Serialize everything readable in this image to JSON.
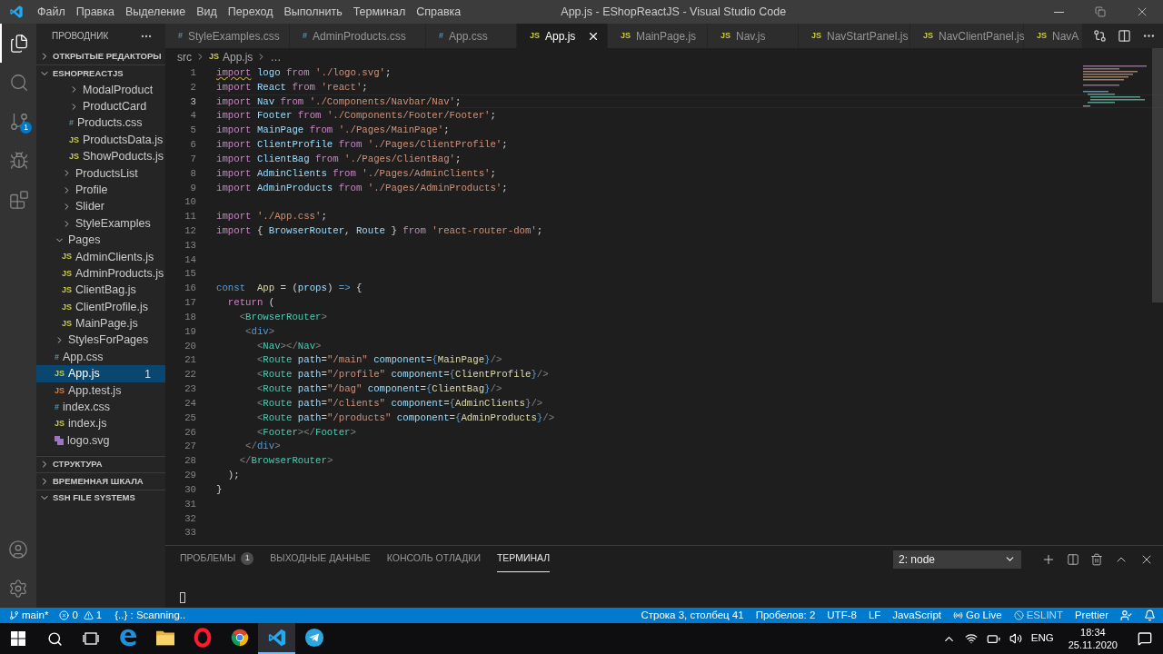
{
  "title_bar": {
    "menu": [
      "Файл",
      "Правка",
      "Выделение",
      "Вид",
      "Переход",
      "Выполнить",
      "Терминал",
      "Справка"
    ],
    "title": "App.js - EShopReactJS - Visual Studio Code"
  },
  "activity_bar": [
    {
      "kind": "files",
      "selected": true
    },
    {
      "kind": "search",
      "selected": false
    },
    {
      "kind": "scm",
      "selected": false,
      "badge": "1"
    },
    {
      "kind": "debug",
      "selected": false
    },
    {
      "kind": "extensions",
      "selected": false
    }
  ],
  "sidebar": {
    "title": "ПРОВОДНИК",
    "sections": [
      {
        "label": "ОТКРЫТЫЕ РЕДАКТОРЫ",
        "expanded": false
      },
      {
        "label": "ESHOPREACTJS",
        "expanded": true,
        "tree": [
          {
            "kind": "group",
            "children": [
              {
                "kind": "group",
                "children": [
                  {
                    "kind": "folder",
                    "label": "ModalProduct",
                    "expanded": false,
                    "selected": false
                  },
                  {
                    "kind": "folder",
                    "label": "ProductCard",
                    "expanded": false,
                    "selected": false
                  },
                  {
                    "kind": "css",
                    "icon_text": "#",
                    "label": "Products.css",
                    "selected": false
                  },
                  {
                    "kind": "js",
                    "icon_text": "JS",
                    "label": "ProductsData.js",
                    "selected": false
                  },
                  {
                    "kind": "js",
                    "icon_text": "JS",
                    "label": "ShowPoducts.js",
                    "selected": false
                  }
                ]
              },
              {
                "kind": "folder",
                "label": "ProductsList",
                "expanded": false,
                "selected": false
              },
              {
                "kind": "folder",
                "label": "Profile",
                "expanded": false,
                "selected": false
              },
              {
                "kind": "folder",
                "label": "Slider",
                "expanded": false,
                "selected": false
              },
              {
                "kind": "folder",
                "label": "StyleExamples",
                "expanded": false,
                "selected": false
              }
            ]
          },
          {
            "kind": "folder",
            "label": "Pages",
            "expanded": true,
            "selected": false,
            "children": [
              {
                "kind": "js",
                "icon_text": "JS",
                "label": "AdminClients.js",
                "selected": false
              },
              {
                "kind": "js",
                "icon_text": "JS",
                "label": "AdminProducts.js",
                "selected": false
              },
              {
                "kind": "js",
                "icon_text": "JS",
                "label": "ClientBag.js",
                "selected": false
              },
              {
                "kind": "js",
                "icon_text": "JS",
                "label": "ClientProfile.js",
                "selected": false
              },
              {
                "kind": "js",
                "icon_text": "JS",
                "label": "MainPage.js",
                "selected": false
              }
            ]
          },
          {
            "kind": "folder",
            "label": "StylesForPages",
            "expanded": false,
            "selected": false
          },
          {
            "kind": "css",
            "icon_text": "#",
            "label": "App.css",
            "selected": false
          },
          {
            "kind": "js",
            "icon_text": "JS",
            "label": "App.js",
            "selected": true,
            "badge": "1"
          },
          {
            "kind": "test",
            "icon_text": "JS",
            "label": "App.test.js",
            "selected": false
          },
          {
            "kind": "css",
            "icon_text": "#",
            "label": "index.css",
            "selected": false
          },
          {
            "kind": "js",
            "icon_text": "JS",
            "label": "index.js",
            "selected": false
          },
          {
            "kind": "svg",
            "label": "logo.svg",
            "selected": false
          }
        ]
      },
      {
        "label": "СТРУКТУРА",
        "expanded": false
      },
      {
        "label": "ВРЕМЕННАЯ ШКАЛА",
        "expanded": false
      },
      {
        "label": "SSH FILE SYSTEMS",
        "expanded": true
      }
    ]
  },
  "tabs": [
    {
      "kind": "css",
      "icon_text": "#",
      "label": "StyleExamples.css",
      "selected": false
    },
    {
      "kind": "css",
      "icon_text": "#",
      "label": "AdminProducts.css",
      "selected": false
    },
    {
      "kind": "css",
      "icon_text": "#",
      "label": "App.css",
      "selected": false
    },
    {
      "kind": "js",
      "icon_text": "JS",
      "label": "App.js",
      "selected": true
    },
    {
      "kind": "js",
      "icon_text": "JS",
      "label": "MainPage.js",
      "selected": false
    },
    {
      "kind": "js",
      "icon_text": "JS",
      "label": "Nav.js",
      "selected": false
    },
    {
      "kind": "js",
      "icon_text": "JS",
      "label": "NavStartPanel.js",
      "selected": false
    },
    {
      "kind": "js",
      "icon_text": "JS",
      "label": "NavClientPanel.js",
      "selected": false
    },
    {
      "kind": "js",
      "icon_text": "JS",
      "label": "NavA",
      "selected": false
    }
  ],
  "breadcrumb": [
    {
      "kind": "folder",
      "text": "src"
    },
    {
      "kind": "file",
      "icon_text": "JS",
      "text": "App.js"
    },
    {
      "kind": "more",
      "text": "…"
    }
  ],
  "editor": {
    "lines": [
      {
        "number": "1",
        "tokens": [
          {
            "kind": "kw",
            "text": "import",
            "warning": true
          },
          {
            "kind": "id",
            "text": " logo"
          },
          {
            "kind": "kw",
            "text": " from"
          },
          {
            "kind": "str",
            "text": " './logo.svg'"
          },
          {
            "kind": "p",
            "text": ";"
          }
        ]
      },
      {
        "number": "2",
        "tokens": [
          {
            "kind": "kw",
            "text": "import"
          },
          {
            "kind": "id",
            "text": " React"
          },
          {
            "kind": "kw",
            "text": " from"
          },
          {
            "kind": "str",
            "text": " 'react'"
          },
          {
            "kind": "p",
            "text": ";"
          }
        ]
      },
      {
        "number": "3",
        "current": true,
        "tokens": [
          {
            "kind": "kw",
            "text": "import"
          },
          {
            "kind": "id",
            "text": " Nav"
          },
          {
            "kind": "kw",
            "text": " from"
          },
          {
            "kind": "str",
            "text": " './Components/Navbar/Nav'"
          },
          {
            "kind": "p",
            "text": ";"
          }
        ]
      },
      {
        "number": "4",
        "tokens": [
          {
            "kind": "kw",
            "text": "import"
          },
          {
            "kind": "id",
            "text": " Footer"
          },
          {
            "kind": "kw",
            "text": " from"
          },
          {
            "kind": "str",
            "text": " './Components/Footer/Footer'"
          },
          {
            "kind": "p",
            "text": ";"
          }
        ]
      },
      {
        "number": "5",
        "tokens": [
          {
            "kind": "kw",
            "text": "import"
          },
          {
            "kind": "id",
            "text": " MainPage"
          },
          {
            "kind": "kw",
            "text": " from"
          },
          {
            "kind": "str",
            "text": " './Pages/MainPage'"
          },
          {
            "kind": "p",
            "text": ";"
          }
        ]
      },
      {
        "number": "6",
        "tokens": [
          {
            "kind": "kw",
            "text": "import"
          },
          {
            "kind": "id",
            "text": " ClientProfile"
          },
          {
            "kind": "kw",
            "text": " from"
          },
          {
            "kind": "str",
            "text": " './Pages/ClientProfile'"
          },
          {
            "kind": "p",
            "text": ";"
          }
        ]
      },
      {
        "number": "7",
        "tokens": [
          {
            "kind": "kw",
            "text": "import"
          },
          {
            "kind": "id",
            "text": " ClientBag"
          },
          {
            "kind": "kw",
            "text": " from"
          },
          {
            "kind": "str",
            "text": " './Pages/ClientBag'"
          },
          {
            "kind": "p",
            "text": ";"
          }
        ]
      },
      {
        "number": "8",
        "tokens": [
          {
            "kind": "kw",
            "text": "import"
          },
          {
            "kind": "id",
            "text": " AdminClients"
          },
          {
            "kind": "kw",
            "text": " from"
          },
          {
            "kind": "str",
            "text": " './Pages/AdminClients'"
          },
          {
            "kind": "p",
            "text": ";"
          }
        ]
      },
      {
        "number": "9",
        "tokens": [
          {
            "kind": "kw",
            "text": "import"
          },
          {
            "kind": "id",
            "text": " AdminProducts"
          },
          {
            "kind": "kw",
            "text": " from"
          },
          {
            "kind": "str",
            "text": " './Pages/AdminProducts'"
          },
          {
            "kind": "p",
            "text": ";"
          }
        ]
      },
      {
        "number": "10"
      },
      {
        "number": "11",
        "tokens": [
          {
            "kind": "kw",
            "text": "import"
          },
          {
            "kind": "str",
            "text": " './App.css'"
          },
          {
            "kind": "p",
            "text": ";"
          }
        ]
      },
      {
        "number": "12",
        "tokens": [
          {
            "kind": "kw",
            "text": "import"
          },
          {
            "kind": "p",
            "text": " {"
          },
          {
            "kind": "id",
            "text": " BrowserRouter"
          },
          {
            "kind": "p",
            "text": ","
          },
          {
            "kind": "id",
            "text": " Route"
          },
          {
            "kind": "p",
            "text": " }"
          },
          {
            "kind": "kw",
            "text": " from"
          },
          {
            "kind": "str",
            "text": " 'react-router-dom'"
          },
          {
            "kind": "p",
            "text": ";"
          }
        ]
      },
      {
        "number": "13"
      },
      {
        "number": "14"
      },
      {
        "number": "15"
      },
      {
        "number": "16",
        "tokens": [
          {
            "kind": "st",
            "text": "const"
          },
          {
            "kind": "fn",
            "text": "  App"
          },
          {
            "kind": "p",
            "text": " = ("
          },
          {
            "kind": "id",
            "text": "props"
          },
          {
            "kind": "p",
            "text": ")"
          },
          {
            "kind": "st",
            "text": " =>"
          },
          {
            "kind": "p",
            "text": " {"
          }
        ]
      },
      {
        "number": "17",
        "tokens": [
          {
            "kind": "kw",
            "text": "  return"
          },
          {
            "kind": "p",
            "text": " ("
          }
        ]
      },
      {
        "number": "18",
        "tokens": [
          {
            "kind": "br",
            "text": "    <"
          },
          {
            "kind": "tag",
            "text": "BrowserRouter"
          },
          {
            "kind": "br",
            "text": ">"
          }
        ]
      },
      {
        "number": "19",
        "tokens": [
          {
            "kind": "br",
            "text": "     <"
          },
          {
            "kind": "st",
            "text": "div"
          },
          {
            "kind": "br",
            "text": ">"
          }
        ]
      },
      {
        "number": "20",
        "tokens": [
          {
            "kind": "br",
            "text": "       <"
          },
          {
            "kind": "tag",
            "text": "Nav"
          },
          {
            "kind": "br",
            "text": "></"
          },
          {
            "kind": "tag",
            "text": "Nav"
          },
          {
            "kind": "br",
            "text": ">"
          }
        ]
      },
      {
        "number": "21",
        "tokens": [
          {
            "kind": "br",
            "text": "       <"
          },
          {
            "kind": "tag",
            "text": "Route"
          },
          {
            "kind": "attr",
            "text": " path"
          },
          {
            "kind": "p",
            "text": "="
          },
          {
            "kind": "str",
            "text": "\"/main\""
          },
          {
            "kind": "attr",
            "text": " component"
          },
          {
            "kind": "p",
            "text": "="
          },
          {
            "kind": "st",
            "text": "{"
          },
          {
            "kind": "fn",
            "text": "MainPage"
          },
          {
            "kind": "st",
            "text": "}"
          },
          {
            "kind": "br",
            "text": "/>"
          }
        ]
      },
      {
        "number": "22",
        "tokens": [
          {
            "kind": "br",
            "text": "       <"
          },
          {
            "kind": "tag",
            "text": "Route"
          },
          {
            "kind": "attr",
            "text": " path"
          },
          {
            "kind": "p",
            "text": "="
          },
          {
            "kind": "str",
            "text": "\"/profile\""
          },
          {
            "kind": "attr",
            "text": " component"
          },
          {
            "kind": "p",
            "text": "="
          },
          {
            "kind": "st",
            "text": "{"
          },
          {
            "kind": "fn",
            "text": "ClientProfile"
          },
          {
            "kind": "st",
            "text": "}"
          },
          {
            "kind": "br",
            "text": "/>"
          }
        ]
      },
      {
        "number": "23",
        "tokens": [
          {
            "kind": "br",
            "text": "       <"
          },
          {
            "kind": "tag",
            "text": "Route"
          },
          {
            "kind": "attr",
            "text": " path"
          },
          {
            "kind": "p",
            "text": "="
          },
          {
            "kind": "str",
            "text": "\"/bag\""
          },
          {
            "kind": "attr",
            "text": " component"
          },
          {
            "kind": "p",
            "text": "="
          },
          {
            "kind": "st",
            "text": "{"
          },
          {
            "kind": "fn",
            "text": "ClientBag"
          },
          {
            "kind": "st",
            "text": "}"
          },
          {
            "kind": "br",
            "text": "/>"
          }
        ]
      },
      {
        "number": "24",
        "tokens": [
          {
            "kind": "br",
            "text": "       <"
          },
          {
            "kind": "tag",
            "text": "Route"
          },
          {
            "kind": "attr",
            "text": " path"
          },
          {
            "kind": "p",
            "text": "="
          },
          {
            "kind": "str",
            "text": "\"/clients\""
          },
          {
            "kind": "attr",
            "text": " component"
          },
          {
            "kind": "p",
            "text": "="
          },
          {
            "kind": "st",
            "text": "{"
          },
          {
            "kind": "fn",
            "text": "AdminClients"
          },
          {
            "kind": "st",
            "text": "}"
          },
          {
            "kind": "br",
            "text": "/>"
          }
        ]
      },
      {
        "number": "25",
        "tokens": [
          {
            "kind": "br",
            "text": "       <"
          },
          {
            "kind": "tag",
            "text": "Route"
          },
          {
            "kind": "attr",
            "text": " path"
          },
          {
            "kind": "p",
            "text": "="
          },
          {
            "kind": "str",
            "text": "\"/products\""
          },
          {
            "kind": "attr",
            "text": " component"
          },
          {
            "kind": "p",
            "text": "="
          },
          {
            "kind": "st",
            "text": "{"
          },
          {
            "kind": "fn",
            "text": "AdminProducts"
          },
          {
            "kind": "st",
            "text": "}"
          },
          {
            "kind": "br",
            "text": "/>"
          }
        ]
      },
      {
        "number": "26",
        "tokens": [
          {
            "kind": "br",
            "text": "       <"
          },
          {
            "kind": "tag",
            "text": "Footer"
          },
          {
            "kind": "br",
            "text": "></"
          },
          {
            "kind": "tag",
            "text": "Footer"
          },
          {
            "kind": "br",
            "text": ">"
          }
        ]
      },
      {
        "number": "27",
        "tokens": [
          {
            "kind": "br",
            "text": "     </"
          },
          {
            "kind": "st",
            "text": "div"
          },
          {
            "kind": "br",
            "text": ">"
          }
        ]
      },
      {
        "number": "28",
        "tokens": [
          {
            "kind": "br",
            "text": "    </"
          },
          {
            "kind": "tag",
            "text": "BrowserRouter"
          },
          {
            "kind": "br",
            "text": ">"
          }
        ]
      },
      {
        "number": "29",
        "tokens": [
          {
            "kind": "p",
            "text": "  );"
          }
        ]
      },
      {
        "number": "30",
        "tokens": [
          {
            "kind": "p",
            "text": "}"
          }
        ]
      },
      {
        "number": "31"
      },
      {
        "number": "32"
      },
      {
        "number": "33"
      }
    ]
  },
  "panel": {
    "tabs": [
      {
        "label": "ПРОБЛЕМЫ",
        "badge": "1",
        "selected": false
      },
      {
        "label": "ВЫХОДНЫЕ ДАННЫЕ",
        "selected": false
      },
      {
        "label": "КОНСОЛЬ ОТЛАДКИ",
        "selected": false
      },
      {
        "label": "ТЕРМИНАЛ",
        "selected": true
      }
    ],
    "terminal_select": "2: node"
  },
  "status_bar": {
    "left": [
      {
        "kind": "branch",
        "text": "main*"
      },
      {
        "kind": "problems",
        "errors": "0",
        "warnings": "1"
      },
      {
        "kind": "plain",
        "text": "{..} : Scanning.."
      }
    ],
    "right": [
      {
        "kind": "plain",
        "text": "Строка 3, столбец 41"
      },
      {
        "kind": "plain",
        "text": "Пробелов: 2"
      },
      {
        "kind": "plain",
        "text": "UTF-8"
      },
      {
        "kind": "plain",
        "text": "LF"
      },
      {
        "kind": "plain",
        "text": "JavaScript"
      },
      {
        "kind": "golive",
        "text": "Go Live"
      },
      {
        "kind": "eslint",
        "text": "ESLINT"
      },
      {
        "kind": "plain",
        "text": "Prettier"
      }
    ]
  },
  "taskbar": {
    "apps": [
      {
        "kind": "edge",
        "active": false
      },
      {
        "kind": "explorer",
        "active": false
      },
      {
        "kind": "opera",
        "active": false
      },
      {
        "kind": "chrome",
        "active": false
      },
      {
        "kind": "vscode",
        "active": true
      },
      {
        "kind": "telegram",
        "active": false
      }
    ],
    "language": "ENG",
    "time": "18:34",
    "date": "25.11.2020"
  }
}
